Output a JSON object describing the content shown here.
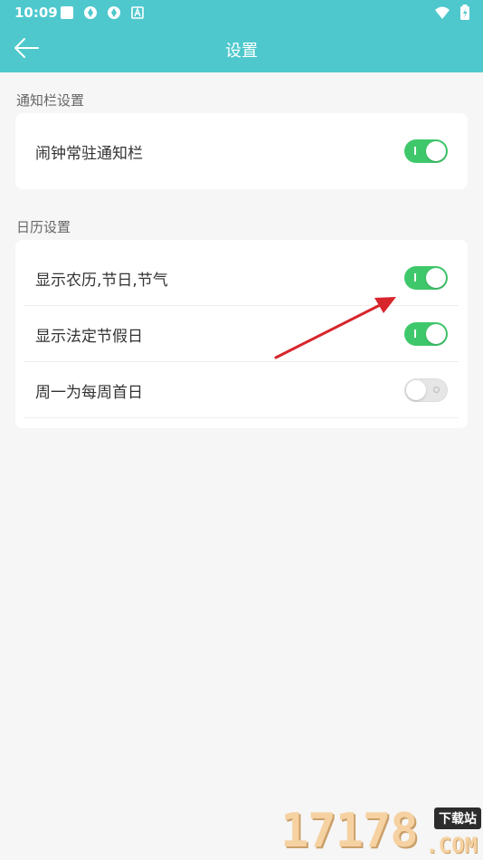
{
  "status_bar": {
    "time": "10:09",
    "battery_glyph": "⚡"
  },
  "header": {
    "title": "设置"
  },
  "sections": [
    {
      "label": "通知栏设置",
      "items": [
        {
          "label": "闹钟常驻通知栏",
          "enabled": true
        }
      ]
    },
    {
      "label": "日历设置",
      "items": [
        {
          "label": "显示农历,节日,节气",
          "enabled": true
        },
        {
          "label": "显示法定节假日",
          "enabled": true
        },
        {
          "label": "周一为每周首日",
          "enabled": false
        }
      ]
    }
  ],
  "watermark": {
    "number": "17178",
    "badge": "下载站",
    "domain": ".COM"
  },
  "colors": {
    "header": "#4ec8cd",
    "toggle_on": "#3fc86b",
    "arrow": "#d8252c"
  }
}
